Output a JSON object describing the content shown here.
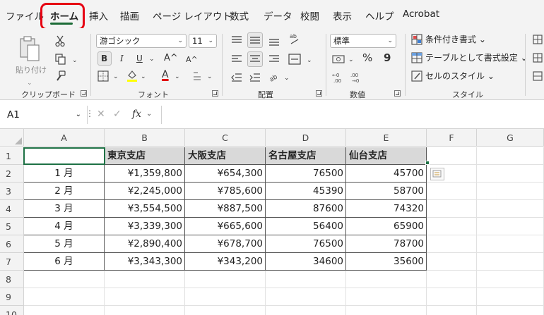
{
  "tabs": [
    "ファイル",
    "ホーム",
    "挿入",
    "描画",
    "ページ レイアウト",
    "数式",
    "データ",
    "校閲",
    "表示",
    "ヘルプ",
    "Acrobat"
  ],
  "ribbon": {
    "clipboard": {
      "paste_label": "貼り付け",
      "group_label": "クリップボード"
    },
    "font": {
      "name": "游ゴシック",
      "size": "11",
      "bold": "B",
      "italic": "I",
      "underline": "U",
      "grow": "A^",
      "shrink": "A^",
      "font_color": "A",
      "group_label": "フォント"
    },
    "alignment": {
      "group_label": "配置"
    },
    "number": {
      "format": "標準",
      "percent": "%",
      "comma": "9",
      "group_label": "数値"
    },
    "styles": {
      "conditional": "条件付き書式 ⌄",
      "table": "テーブルとして書式設定 ⌄",
      "cell": "セルのスタイル ⌄",
      "group_label": "スタイル"
    }
  },
  "formula_bar": {
    "name_box": "A1",
    "fx": "fx"
  },
  "grid": {
    "columns": [
      "A",
      "B",
      "C",
      "D",
      "E",
      "F",
      "G"
    ],
    "rows": [
      "1",
      "2",
      "3",
      "4",
      "5",
      "6",
      "7",
      "8",
      "9",
      "10"
    ],
    "headers": [
      "",
      "東京支店",
      "大阪支店",
      "名古屋支店",
      "仙台支店"
    ],
    "data": [
      [
        "1 月",
        "¥1,359,800",
        "¥654,300",
        "76500",
        "45700"
      ],
      [
        "2 月",
        "¥2,245,000",
        "¥785,600",
        "45390",
        "58700"
      ],
      [
        "3 月",
        "¥3,554,500",
        "¥887,500",
        "87600",
        "74320"
      ],
      [
        "4 月",
        "¥3,339,300",
        "¥665,600",
        "56400",
        "65900"
      ],
      [
        "5 月",
        "¥2,890,400",
        "¥678,700",
        "76500",
        "78700"
      ],
      [
        "6 月",
        "¥3,343,300",
        "¥343,200",
        "34600",
        "35600"
      ]
    ]
  },
  "colors": {
    "accent": "#1e7145",
    "highlight": "#e60012",
    "header_fill": "#d9d9d9"
  }
}
